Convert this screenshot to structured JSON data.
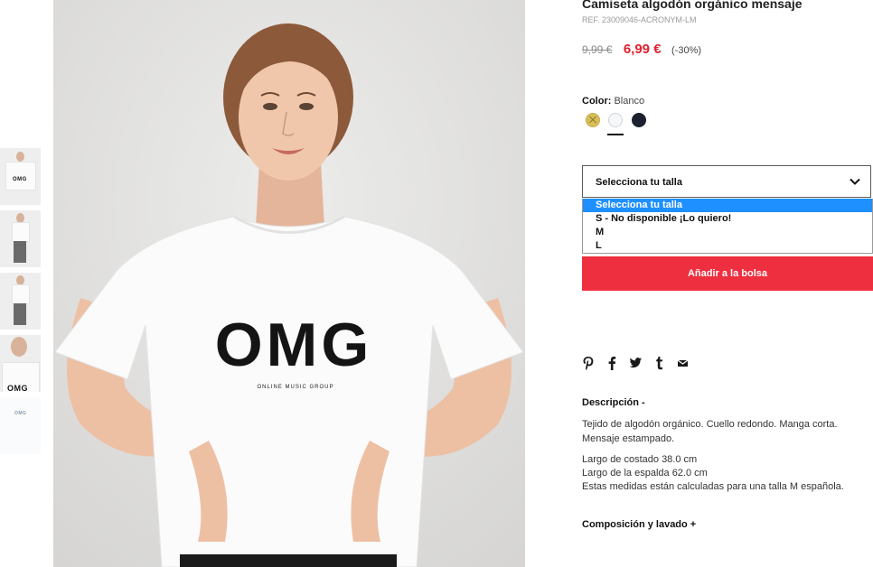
{
  "product": {
    "title": "Camiseta algodón orgánico mensaje",
    "reference": "REF. 23009046-ACRONYM-LM",
    "old_price": "9,99 €",
    "new_price": "6,99 €",
    "discount": "(-30%)"
  },
  "color": {
    "label": "Color:",
    "selected": "Blanco",
    "swatches": [
      "mustard",
      "white",
      "navy"
    ]
  },
  "size_select": {
    "value": "Selecciona tu talla",
    "options": [
      "Selecciona tu talla",
      "S - No disponible ¡Lo quiero!",
      "M",
      "L"
    ]
  },
  "add_to_bag": "Añadir a la bolsa",
  "share_icons": [
    "pinterest-icon",
    "facebook-icon",
    "twitter-icon",
    "tumblr-icon",
    "mail-icon"
  ],
  "description": {
    "title": "Descripción -",
    "text": "Tejido de algodón orgánico. Cuello redondo. Manga corta. Mensaje estampado.",
    "measures": [
      "Largo de costado 38.0 cm",
      "Largo de la espalda 62.0 cm",
      "Estas medidas están calculadas para una talla M española."
    ]
  },
  "composition_title": "Composición y lavado +",
  "image": {
    "shirt_print": "OMG",
    "shirt_subprint": "ONLINE MUSIC GROUP"
  },
  "thumbnail_text": {
    "omg_small": "OMG"
  },
  "colors": {
    "price_red": "#e3202f",
    "button_red": "#ee2f3f",
    "option_highlight": "#1e90ff"
  }
}
